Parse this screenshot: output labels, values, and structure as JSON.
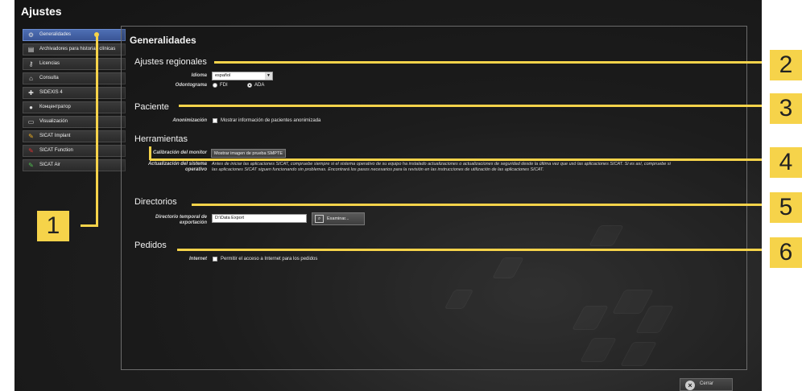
{
  "window": {
    "title": "Ajustes"
  },
  "sidebar": {
    "items": [
      {
        "label": "Generalidades",
        "icon": "gears-icon"
      },
      {
        "label": "Archivadores para historias clínicas",
        "icon": "archive-icon"
      },
      {
        "label": "Licencias",
        "icon": "key-icon"
      },
      {
        "label": "Consulta",
        "icon": "house-icon"
      },
      {
        "label": "SIDEXIS 4",
        "icon": "sidexis-icon"
      },
      {
        "label": "Концентратор",
        "icon": "hub-icon"
      },
      {
        "label": "Visualización",
        "icon": "monitor-icon"
      },
      {
        "label": "SICAT Implant",
        "icon": "implant-icon"
      },
      {
        "label": "SICAT Function",
        "icon": "function-icon"
      },
      {
        "label": "SICAT Air",
        "icon": "air-icon"
      }
    ]
  },
  "main": {
    "title": "Generalidades",
    "regional": {
      "heading": "Ajustes regionales",
      "language_label": "Idioma",
      "language_value": "español",
      "odontogram_label": "Odontograma",
      "odontogram_fdi": "FDI",
      "odontogram_ada": "ADA"
    },
    "patient": {
      "heading": "Paciente",
      "anon_label": "Anonimización",
      "anon_checkbox": "Mostrar información de pacientes anonimizada"
    },
    "tools": {
      "heading": "Herramientas",
      "monitor_label": "Calibración del monitor",
      "monitor_button": "Mostrar imagen de prueba SMPTE",
      "os_update_label": "Actualización del sistema operativo",
      "os_update_text": "Antes de iniciar las aplicaciones SICAT, compruebe siempre si el sistema operativo de su equipo ha instalado actualizaciones o actualizaciones de seguridad desde la última vez que usó las aplicaciones SICAT. Si es así, compruebe si las aplicaciones SICAT siguen funcionando sin problemas. Encontrará los pasos necesarios para la revisión en las instrucciones de utilización de las aplicaciones SICAT."
    },
    "directories": {
      "heading": "Directorios",
      "export_label": "Directorio temporal de exportación",
      "export_value": "D:\\Data Export",
      "browse_button": "Examinar..."
    },
    "orders": {
      "heading": "Pedidos",
      "internet_label": "Internet",
      "internet_checkbox": "Permitir el acceso a Internet para los pedidos"
    }
  },
  "footer": {
    "close_button": "Cerrar"
  },
  "callouts": [
    "1",
    "2",
    "3",
    "4",
    "5",
    "6"
  ],
  "colors": {
    "callout": "#f6d34a",
    "active_tab": "#4a67ad"
  }
}
